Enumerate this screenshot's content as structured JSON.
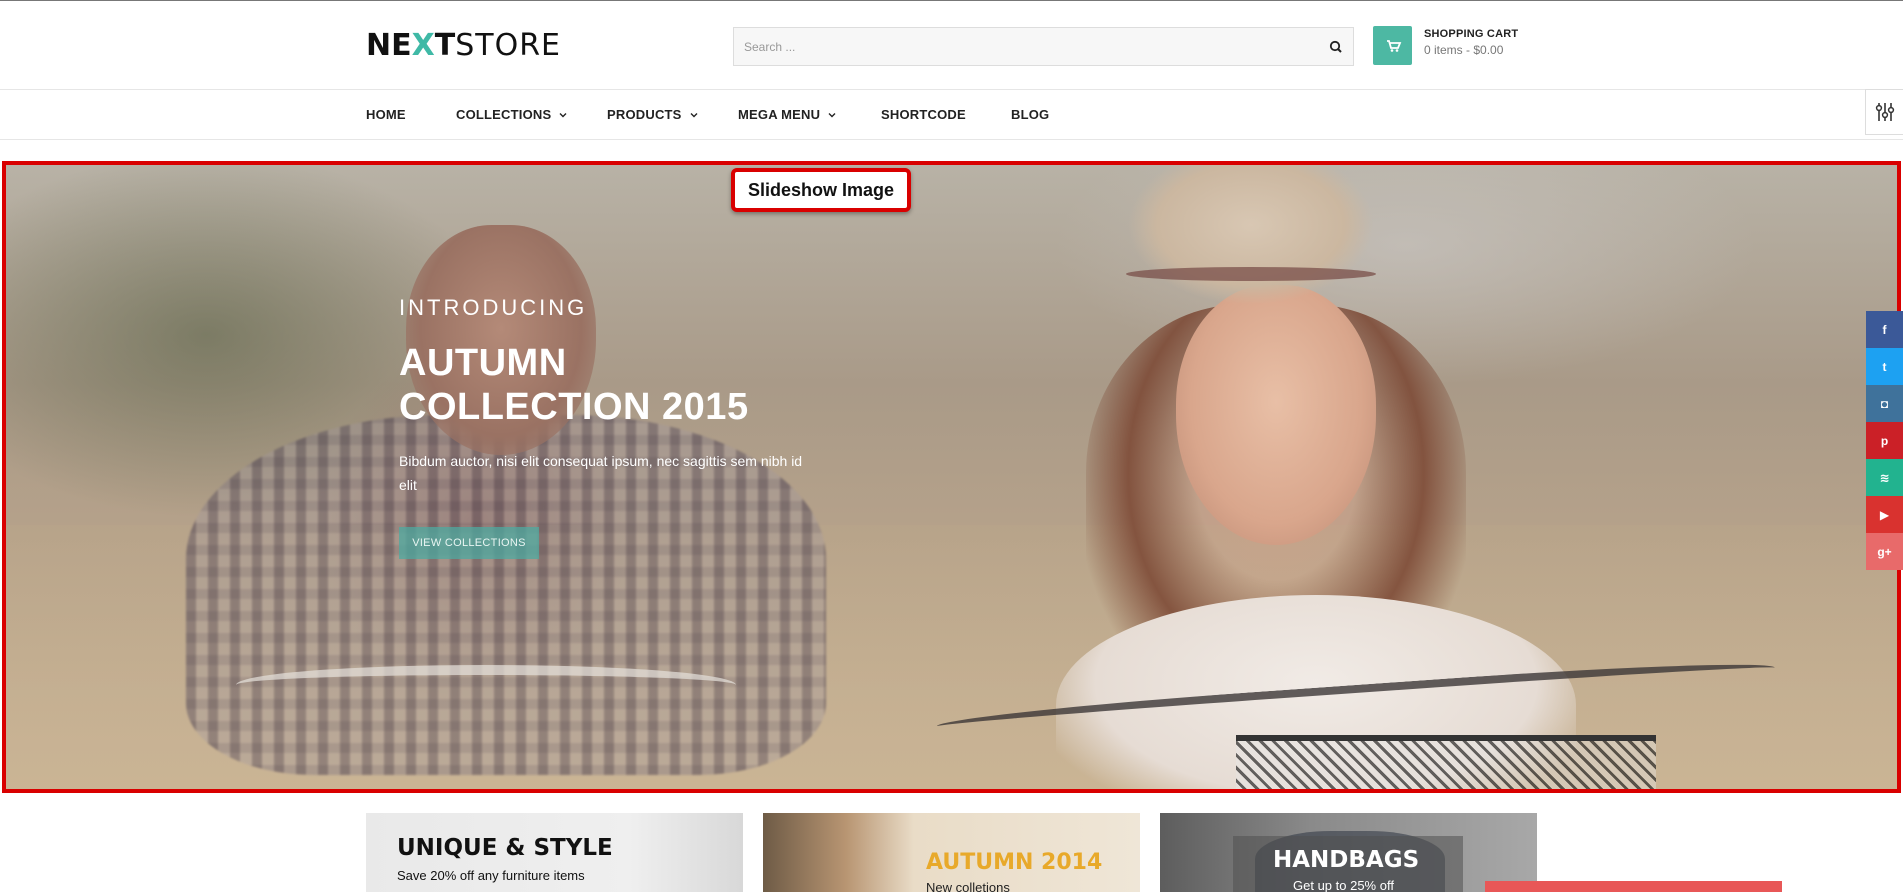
{
  "brand": {
    "logo_bold": "NE",
    "logo_x": "X",
    "logo_t": "T",
    "logo_thin": "STORE",
    "accent": "#4db8a3"
  },
  "header": {
    "search_placeholder": "Search ...",
    "cart_title": "SHOPPING CART",
    "cart_summary": "0 items - $0.00"
  },
  "nav": {
    "items": [
      {
        "label": "HOME",
        "dropdown": false
      },
      {
        "label": "COLLECTIONS",
        "dropdown": true
      },
      {
        "label": "PRODUCTS",
        "dropdown": true
      },
      {
        "label": "MEGA MENU",
        "dropdown": true
      },
      {
        "label": "SHORTCODE",
        "dropdown": false
      },
      {
        "label": "BLOG",
        "dropdown": false
      }
    ]
  },
  "annotation": {
    "label": "Slideshow Image",
    "color": "#d90000"
  },
  "slide": {
    "kicker": "INTRODUCING",
    "headline_line1": "AUTUMN",
    "headline_line2": "COLLECTION 2015",
    "description": "Bibdum auctor, nisi elit consequat ipsum, nec sagittis sem nibh id elit",
    "button_label": "VIEW COLLECTIONS"
  },
  "social": [
    {
      "icon": "facebook-icon",
      "glyph": "f",
      "color": "#3b5998"
    },
    {
      "icon": "twitter-icon",
      "glyph": "t",
      "color": "#1da1f2"
    },
    {
      "icon": "instagram-icon",
      "glyph": "◘",
      "color": "#3f729b"
    },
    {
      "icon": "pinterest-icon",
      "glyph": "p",
      "color": "#cb2027"
    },
    {
      "icon": "rss-icon",
      "glyph": "≋",
      "color": "#22b38f"
    },
    {
      "icon": "youtube-icon",
      "glyph": "▶",
      "color": "#d9322f"
    },
    {
      "icon": "google-plus-icon",
      "glyph": "g+",
      "color": "#e86a6a"
    }
  ],
  "promos": [
    {
      "title": "UNIQUE & STYLE",
      "subtitle": "Save 20% off any furniture items"
    },
    {
      "title": "AUTUMN 2014",
      "subtitle": "New colletions"
    },
    {
      "title": "HANDBAGS",
      "subtitle": "Get up to 25% off"
    }
  ]
}
